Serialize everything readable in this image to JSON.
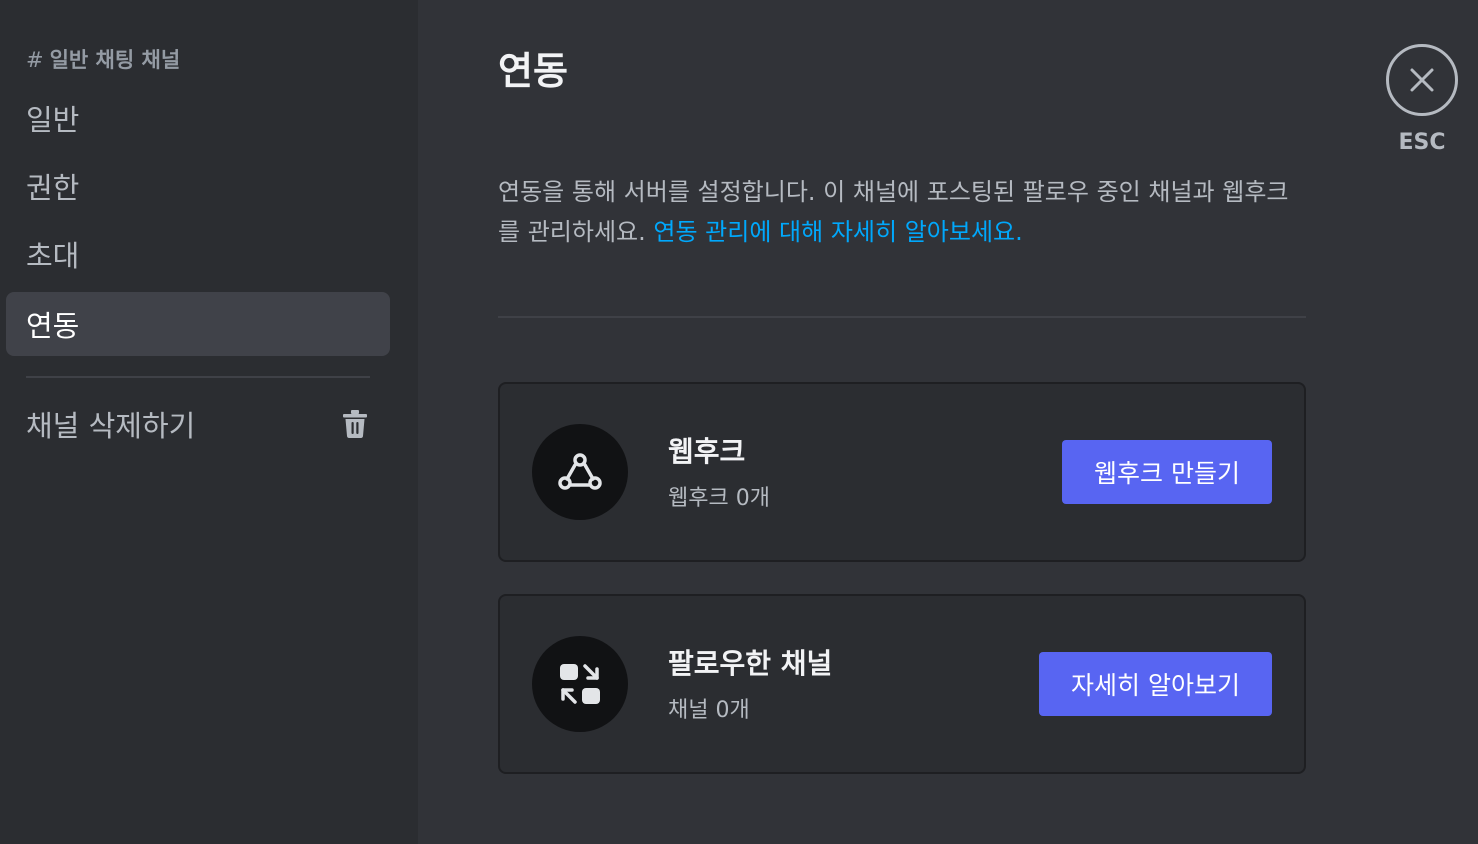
{
  "sidebar": {
    "header": {
      "hash": "#",
      "title": "일반 채팅 채널"
    },
    "items": [
      {
        "label": "일반"
      },
      {
        "label": "권한"
      },
      {
        "label": "초대"
      },
      {
        "label": "연동",
        "selected": true
      }
    ],
    "delete": {
      "label": "채널 삭제하기",
      "icon": "trash-icon"
    }
  },
  "main": {
    "title": "연동",
    "description": "연동을 통해 서버를 설정합니다. 이 채널에 포스팅된 팔로우 중인 채널과 웹후크를 관리하세요.",
    "description_link": "연동 관리에 대해 자세히 알아보세요.",
    "cards": [
      {
        "icon": "webhook-icon",
        "title": "웹후크",
        "subtitle": "웹후크 0개",
        "button": "웹후크 만들기"
      },
      {
        "icon": "followed-channels-icon",
        "title": "팔로우한 채널",
        "subtitle": "채널 0개",
        "button": "자세히 알아보기"
      }
    ]
  },
  "close": {
    "icon": "close-icon",
    "label": "ESC"
  },
  "colors": {
    "background": "#313338",
    "sidebar": "#2b2d31",
    "selected": "#404249",
    "accent_button": "#5865f2",
    "link": "#00a8fc"
  }
}
